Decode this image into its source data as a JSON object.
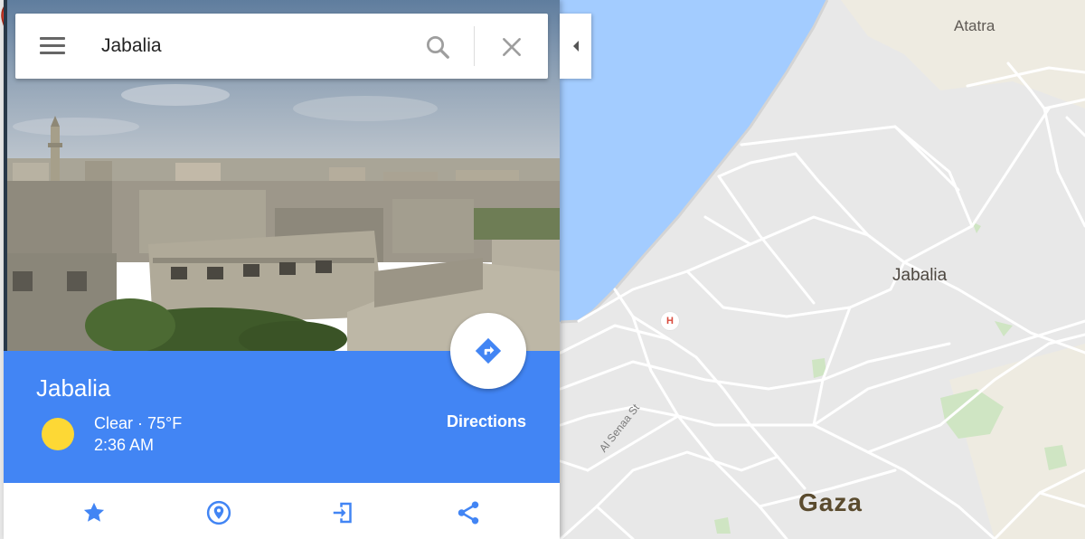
{
  "search": {
    "value": "Jabalia",
    "menu_icon": "menu-icon",
    "search_icon": "search-icon",
    "close_icon": "close-icon"
  },
  "place": {
    "title": "Jabalia",
    "weather_icon": "sun-icon",
    "weather_condition": "Clear · 75°F",
    "local_time": "2:36 AM",
    "directions_label": "Directions",
    "hero_image_alt": "photo"
  },
  "actions": [
    {
      "icon": "star-icon"
    },
    {
      "icon": "nearby-pin-icon"
    },
    {
      "icon": "send-to-device-icon"
    },
    {
      "icon": "share-icon"
    }
  ],
  "map": {
    "labels": {
      "atatra": "Atatra",
      "jabalia": "Jabalia",
      "gaza": "Gaza",
      "street": "Al Senaa St",
      "hospital": "H"
    }
  },
  "colors": {
    "accent_blue": "#4285f4",
    "water": "#a3ccff",
    "land": "#e8e8e8",
    "road": "#ffffff",
    "park": "#cfe5c3",
    "marker_red": "#ea4335",
    "sun_yellow": "#fdd835"
  }
}
